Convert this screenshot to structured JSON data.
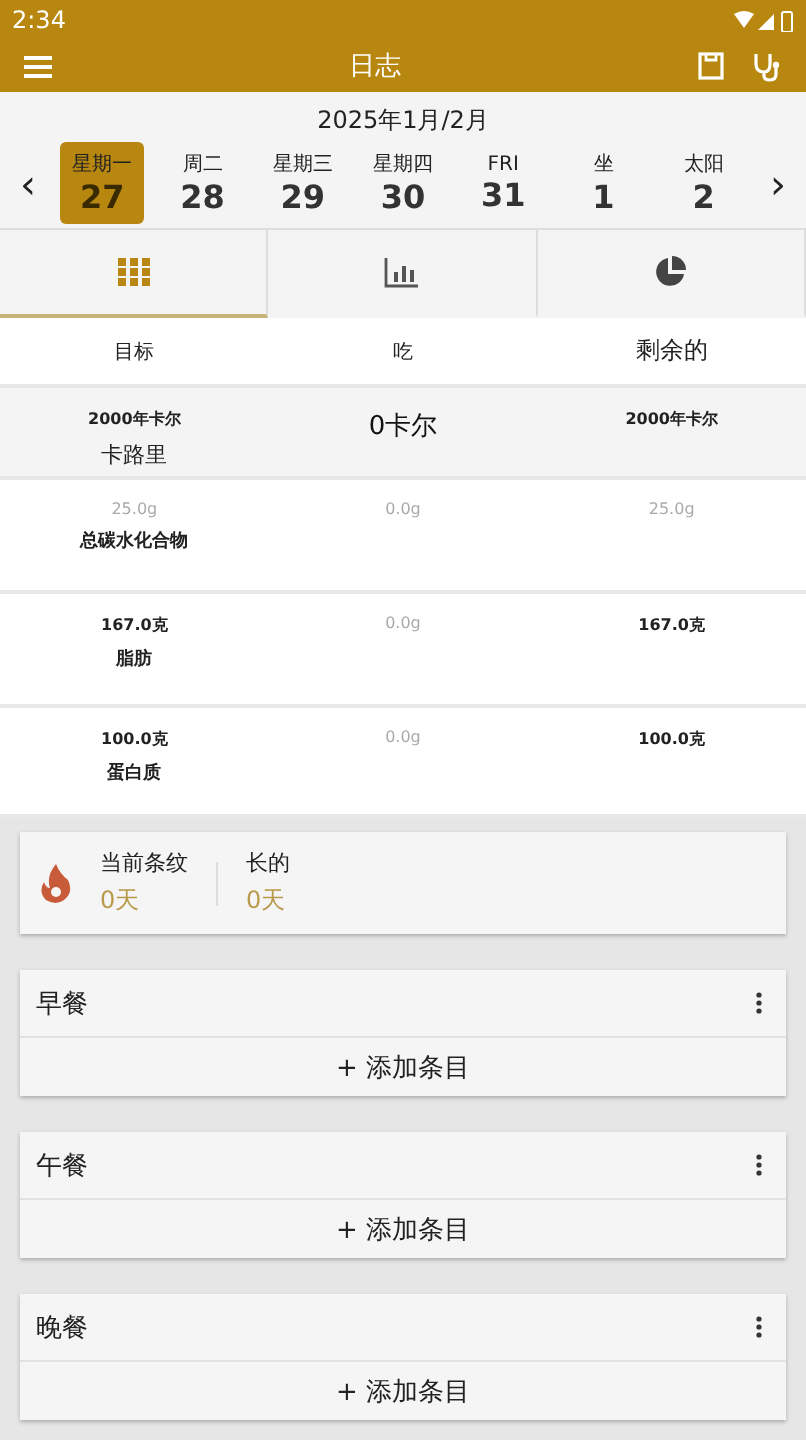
{
  "status_bar": {
    "time": "2:34"
  },
  "app_bar": {
    "title": "日志"
  },
  "calendar": {
    "month": "2025年1月/2月",
    "prev": "‹",
    "next": "›",
    "days": [
      {
        "weekday": "星期一",
        "date": "27",
        "selected": true
      },
      {
        "weekday": "周二",
        "date": "28",
        "selected": false
      },
      {
        "weekday": "星期三",
        "date": "29",
        "selected": false
      },
      {
        "weekday": "星期四",
        "date": "30",
        "selected": false
      },
      {
        "weekday": "FRI",
        "date": "31",
        "selected": false
      },
      {
        "weekday": "坐",
        "date": "1",
        "selected": false
      },
      {
        "weekday": "太阳",
        "date": "2",
        "selected": false
      }
    ]
  },
  "tabs": [
    {
      "kind": "grid",
      "selected": true
    },
    {
      "kind": "bars",
      "selected": false
    },
    {
      "kind": "pie",
      "selected": false
    }
  ],
  "table": {
    "columns": [
      "目标",
      "吃",
      "剩余的"
    ],
    "rows": [
      {
        "kind": "calories",
        "goal": "2000年卡尔",
        "label": "卡路里",
        "eaten": "0卡尔",
        "remaining": "2000年卡尔",
        "dimmed": false
      },
      {
        "kind": "nutrient",
        "goal": "25.0g",
        "label": "总碳水化合物",
        "eaten": "0.0g",
        "remaining": "25.0g",
        "dimmed": true
      },
      {
        "kind": "nutrient",
        "goal": "167.0克",
        "label": "脂肪",
        "eaten": "0.0g",
        "remaining": "167.0克",
        "dimmed": false
      },
      {
        "kind": "nutrient",
        "goal": "100.0克",
        "label": "蛋白质",
        "eaten": "0.0g",
        "remaining": "100.0克",
        "dimmed": false
      }
    ]
  },
  "streak": {
    "current_label": "当前条纹",
    "current_value": "0天",
    "longest_label": "长的",
    "longest_value": "0天"
  },
  "meals": [
    {
      "name": "早餐",
      "add": "+ 添加条目"
    },
    {
      "name": "午餐",
      "add": "+ 添加条目"
    },
    {
      "name": "晚餐",
      "add": "+ 添加条目"
    }
  ]
}
